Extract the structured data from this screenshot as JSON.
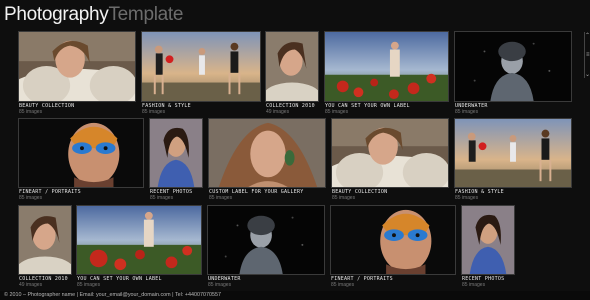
{
  "header": {
    "logo_primary": "Photography",
    "logo_secondary": "Template"
  },
  "gallery": {
    "row1": [
      {
        "label": "BEAUTY COLLECTION",
        "count": "85 images"
      },
      {
        "label": "FASHION & STYLE",
        "count": "85 images"
      },
      {
        "label": "COLLECTION 2010",
        "count": "49 images"
      },
      {
        "label": "YOU CAN SET YOUR OWN LABEL",
        "count": "85 images"
      },
      {
        "label": "UNDERWATER",
        "count": "85 images"
      }
    ],
    "row2": [
      {
        "label": "FINEART / PORTRAITS",
        "count": "85 images"
      },
      {
        "label": "RECENT PHOTOS",
        "count": "85 images"
      },
      {
        "label": "CUSTOM LABEL FOR YOUR GALLERY",
        "count": "85 images"
      },
      {
        "label": "BEAUTY COLLECTION",
        "count": "85 images"
      },
      {
        "label": "FASHION & STYLE",
        "count": "85 images"
      }
    ],
    "row3": [
      {
        "label": "COLLECTION 2010",
        "count": "49 images"
      },
      {
        "label": "YOU CAN SET YOUR OWN LABEL",
        "count": "85 images"
      },
      {
        "label": "UNDERWATER",
        "count": "85 images"
      },
      {
        "label": "FINEART / PORTRAITS",
        "count": "85 images"
      },
      {
        "label": "RECENT PHOTOS",
        "count": "85 images"
      }
    ]
  },
  "footer": {
    "text": "© 2010 – Photographer name | Email: your_email@your_domain.com | Tel: +44007070557"
  }
}
